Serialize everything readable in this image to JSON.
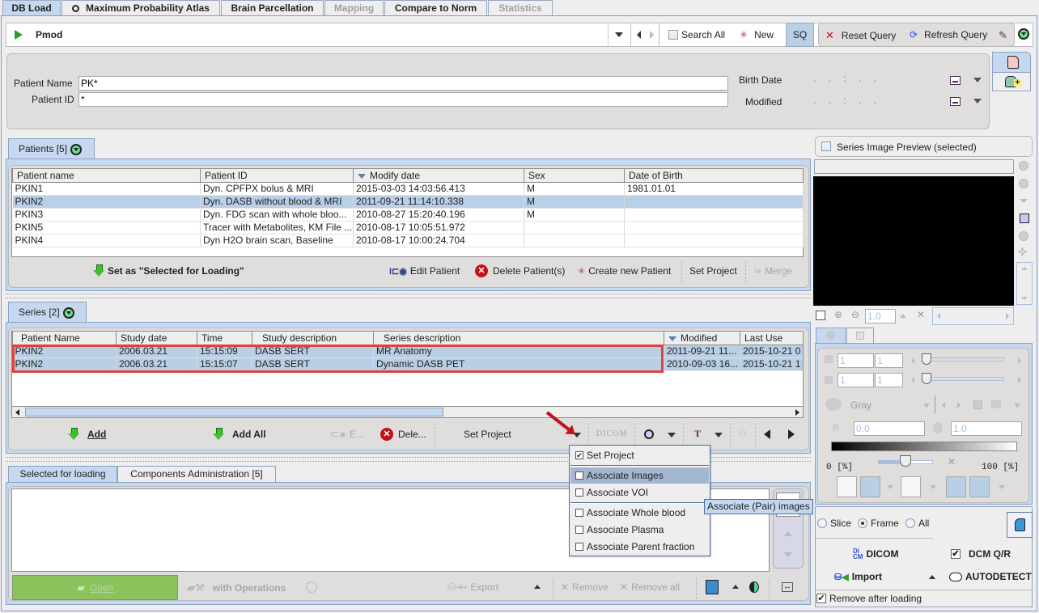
{
  "top_tabs": [
    {
      "label": "DB Load",
      "state": "active"
    },
    {
      "label": "Maximum Probability Atlas",
      "state": "normal",
      "icon": "radio-target-icon"
    },
    {
      "label": "Brain Parcellation",
      "state": "normal"
    },
    {
      "label": "Mapping",
      "state": "disabled"
    },
    {
      "label": "Compare to Norm",
      "state": "normal"
    },
    {
      "label": "Statistics",
      "state": "disabled"
    }
  ],
  "toolbar": {
    "database": "Pmod",
    "search_all": "Search All",
    "new": "New",
    "sq": "SQ",
    "reset_query": "Reset Query",
    "refresh_query": "Refresh Query"
  },
  "query": {
    "patient_name_label": "Patient Name",
    "patient_name_value": "PK*",
    "patient_id_label": "Patient ID",
    "patient_id_value": "*",
    "birth_date_label": "Birth Date",
    "modified_label": "Modified",
    "date_mask": ".   .   :   .   ."
  },
  "patients": {
    "tab_label": "Patients [5]",
    "columns": [
      "Patient name",
      "Patient ID",
      "Modify date",
      "Sex",
      "Date of Birth"
    ],
    "rows": [
      [
        "PKIN1",
        "Dyn. CPFPX bolus & MRI",
        "2015-03-03 14:03:56.413",
        "M",
        "1981.01.01"
      ],
      [
        "PKIN2",
        "Dyn. DASB without blood & MRI",
        "2011-09-21 11:14:10.338",
        "M",
        ""
      ],
      [
        "PKIN3",
        "Dyn. FDG scan with whole bloo...",
        "2010-08-27 15:20:40.196",
        "M",
        ""
      ],
      [
        "PKIN5",
        "Tracer with Metabolites, KM File ...",
        "2010-08-17 10:05:51.972",
        "",
        ""
      ],
      [
        "PKIN4",
        "Dyn H2O brain scan, Baseline",
        "2010-08-17 10:00:24.704",
        "",
        ""
      ]
    ],
    "selected_row": 1,
    "actions": {
      "set_selected": "Set as \"Selected for Loading\"",
      "edit": "Edit Patient",
      "delete": "Delete Patient(s)",
      "create": "Create new Patient",
      "set_project": "Set Project",
      "merge": "Merge"
    }
  },
  "series": {
    "tab_label": "Series [2]",
    "columns": [
      "Patient Name",
      "Study date",
      "Time",
      "Study description",
      "Series description",
      "Modified",
      "Last Use"
    ],
    "rows": [
      [
        "PKIN2",
        "2006.03.21",
        "15:15:09",
        "DASB SERT",
        "MR Anatomy",
        "2011-09-21 11...",
        "2015-10-21 0"
      ],
      [
        "PKIN2",
        "2006.03.21",
        "15:15:07",
        "DASB SERT",
        "Dynamic DASB PET",
        "2010-09-03 16...",
        "2015-10-21 1"
      ]
    ],
    "actions": {
      "add": "Add",
      "add_all": "Add All",
      "edit": "E...",
      "delete": "Dele...",
      "set_project": "Set Project",
      "dicom": "DICOM"
    }
  },
  "popup_menu": {
    "items": [
      {
        "label": "Set Project",
        "checked": true,
        "highlighted": false
      },
      {
        "label": "Associate Images",
        "checked": false,
        "highlighted": true
      },
      {
        "label": "Associate VOI",
        "checked": false,
        "highlighted": false
      },
      {
        "label": "Associate Whole blood",
        "checked": false,
        "highlighted": false
      },
      {
        "label": "Associate Plasma",
        "checked": false,
        "highlighted": false
      },
      {
        "label": "Associate Parent fraction",
        "checked": false,
        "highlighted": false
      }
    ],
    "tooltip": "Associate (Pair) images"
  },
  "loading": {
    "tabs": [
      "Selected for loading",
      "Components Administration [5]"
    ],
    "open": "Open",
    "with_operations": "with Operations",
    "export": "Export",
    "remove": "Remove",
    "remove_all": "Remove all"
  },
  "preview": {
    "label": "Series Image Preview (selected)",
    "checked": false,
    "zoom_value": "1.0",
    "frame_a": "1",
    "frame_b": "1",
    "slice_a": "1",
    "slice_b": "1",
    "colortable": "Gray",
    "min_value": "0.0",
    "max_value": "1.0",
    "range_min_label": "0",
    "range_max_label": "100",
    "range_unit": "[%]",
    "range_slider_fraction": 0.5
  },
  "load_options": {
    "radio": [
      {
        "label": "Slice",
        "selected": false
      },
      {
        "label": "Frame",
        "selected": true
      },
      {
        "label": "All",
        "selected": false
      }
    ],
    "dicom": "DICOM",
    "dcm_qr": "DCM Q/R",
    "dcm_qr_checked": true,
    "import": "Import",
    "autodetect": "AUTODETECT",
    "remove_after_loading": "Remove after loading",
    "remove_after_loading_checked": true
  }
}
